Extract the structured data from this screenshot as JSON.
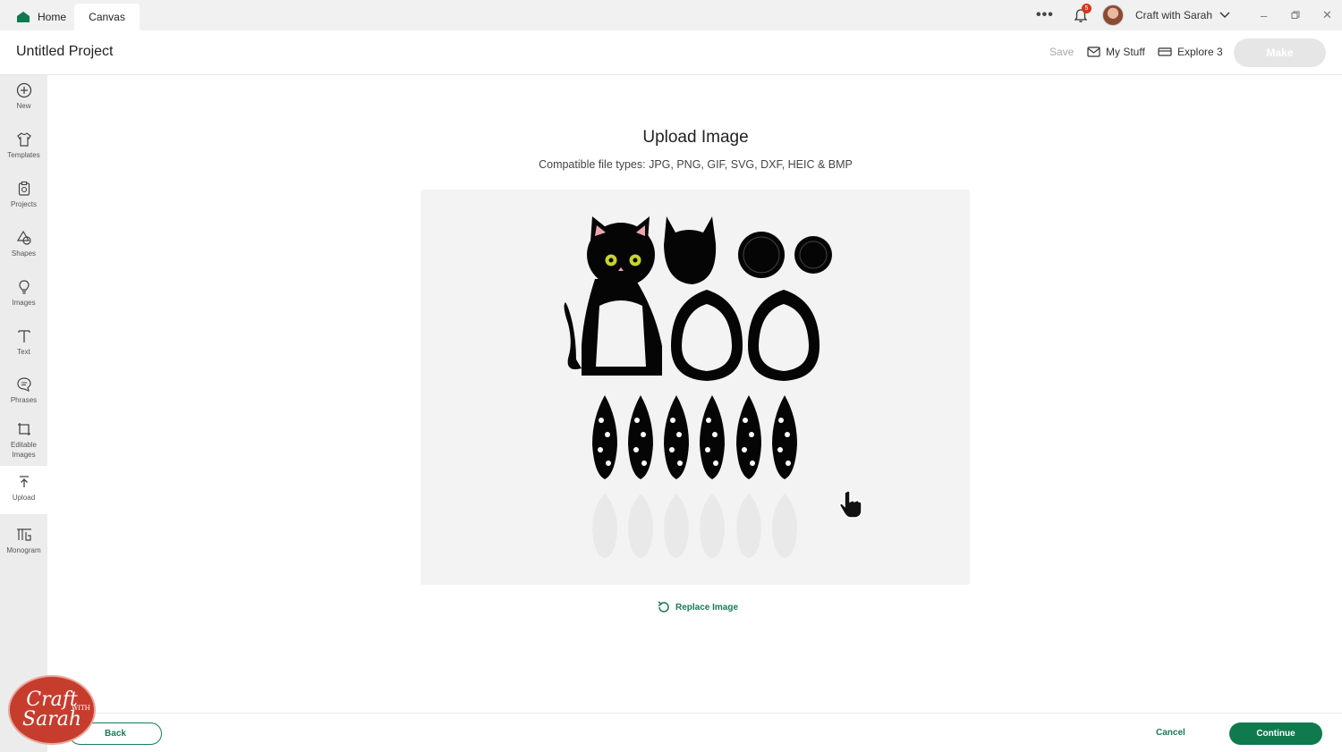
{
  "titlebar": {
    "tabs": [
      {
        "label": "Home"
      },
      {
        "label": "Canvas"
      }
    ],
    "notification_count": "5",
    "user_name": "Craft with Sarah"
  },
  "header": {
    "project_title": "Untitled Project",
    "save_label": "Save",
    "my_stuff_label": "My Stuff",
    "machine_label": "Explore 3",
    "make_label": "Make"
  },
  "sidebar": {
    "items": [
      {
        "label": "New",
        "icon": "plus-circle-icon"
      },
      {
        "label": "Templates",
        "icon": "shirt-icon"
      },
      {
        "label": "Projects",
        "icon": "clipboard-icon"
      },
      {
        "label": "Shapes",
        "icon": "shapes-icon"
      },
      {
        "label": "Images",
        "icon": "lightbulb-icon"
      },
      {
        "label": "Text",
        "icon": "text-icon"
      },
      {
        "label": "Phrases",
        "icon": "speech-bubble-icon"
      },
      {
        "label": "Editable Images",
        "icon": "editable-image-icon"
      },
      {
        "label": "Upload",
        "icon": "upload-icon"
      },
      {
        "label": "Monogram",
        "icon": "monogram-icon"
      }
    ],
    "active": "Upload"
  },
  "main": {
    "title": "Upload Image",
    "subtitle": "Compatible file types:  JPG, PNG, GIF, SVG, DXF, HEIC & BMP",
    "replace_label": "Replace Image"
  },
  "footer": {
    "back_label": "Back",
    "cancel_label": "Cancel",
    "continue_label": "Continue"
  },
  "watermark": {
    "line1": "Craft",
    "word_with": "WITH",
    "line2": "Sarah"
  },
  "colors": {
    "accent": "#0f7a4e",
    "sidebar_bg": "#ececec",
    "preview_bg": "#f3f3f3",
    "badge": "#d6361b"
  }
}
